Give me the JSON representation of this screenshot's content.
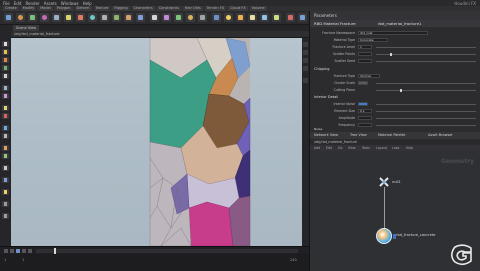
{
  "menubar": {
    "items": [
      "File",
      "Edit",
      "Render",
      "Assets",
      "Windows",
      "Help"
    ],
    "window_title": "Houdini FX"
  },
  "shelf_tabs": [
    "Create",
    "Modify",
    "Model",
    "Polygon",
    "Deform",
    "Texture",
    "Rigging",
    "Characters",
    "Constraints",
    "Hair Utils",
    "Terrain FX",
    "Cloud FX",
    "Volume"
  ],
  "viewport": {
    "tab_label": "Scene View",
    "path": "/obj/rbd_material_fracture"
  },
  "timeline": {
    "start_frame": "1",
    "current_frame": "1",
    "end_frame": "240"
  },
  "params": {
    "panel_tab": "Parameters",
    "node_type": "RBD Material Fracture",
    "node_name": "rbd_material_fracture1",
    "rows": [
      {
        "label": "Fracture Namespace",
        "value": "rbd_mat"
      },
      {
        "label": "Material Type",
        "value": "Concrete"
      },
      {
        "label": "Fracture Level",
        "value": "1"
      },
      {
        "label": "Scatter Points",
        "value": ""
      },
      {
        "label": "Scatter Seed",
        "value": ""
      }
    ],
    "sections": [
      "Chipping",
      "Interior Detail",
      "Noise"
    ],
    "rows2": [
      {
        "label": "Fracture Type",
        "value": "Voronoi"
      },
      {
        "label": "Cluster Scale",
        "value": ""
      },
      {
        "label": "Cutting Plane",
        "value": ""
      },
      {
        "label": "Interior Noise",
        "value": ""
      },
      {
        "label": "Element Size",
        "value": "0.1"
      },
      {
        "label": "Amplitude",
        "value": ""
      },
      {
        "label": "Frequency",
        "value": ""
      }
    ]
  },
  "network": {
    "tabs": [
      "Network View",
      "Tree View",
      "Material Palette",
      "Asset Browser"
    ],
    "path": "/obj/rbd_material_fracture",
    "menu": [
      "Add",
      "Edit",
      "Go",
      "View",
      "Tools",
      "Layout",
      "Labs",
      "Help"
    ],
    "context_label": "Geometry",
    "merge_node": "null1",
    "fracture_node": "rbd_fracture_concrete"
  },
  "colors": {
    "accent": "#3a7fd0",
    "viewport_bg": "#aebdc7"
  }
}
